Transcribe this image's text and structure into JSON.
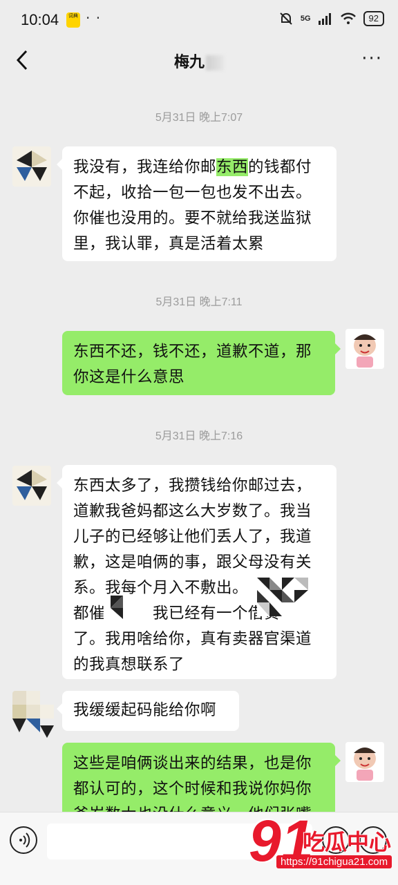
{
  "status_bar": {
    "time": "10:04",
    "app_badge": "词典",
    "network": "5G",
    "battery": "92"
  },
  "header": {
    "title": "梅九",
    "back_icon": "chevron-left-icon",
    "more_label": "···"
  },
  "messages": [
    {
      "timestamp": "5月31日 晚上7:07"
    },
    {
      "side": "left",
      "pre": "我没有，我连给你邮",
      "highlight": "东西",
      "post": "的钱都付不起，收拾一包一包也发不出去。你催也没用的。要不就给我送监狱里，我认罪，真是活着太累"
    },
    {
      "timestamp": "5月31日 晚上7:11"
    },
    {
      "side": "right",
      "text": "东西不还，钱不还，道歉不道，那你这是什么意思"
    },
    {
      "timestamp": "5月31日 晚上7:16"
    },
    {
      "side": "left",
      "text": "东西太多了，我攒钱给你邮过去，道歉我爸妈都这么大岁数了。我当儿子的已经够让他们丢人了，我道歉，这是咱俩的事，跟父母没有关系。我每个月入不敷出。　　　　　都催　　　我已经有一个借贷　　　了。我用啥给你，真有卖器官渠道的我真想联系了"
    },
    {
      "side": "left",
      "text": "我缓缓起码能给你啊"
    },
    {
      "side": "right",
      "text": "这些是咱俩谈出来的结果，也是你都认可的，这个时候和我说你妈你爸岁数大也没什么意义，他们张嘴"
    }
  ],
  "input_bar": {
    "voice_icon": "voice-icon",
    "emoji_icon": "emoji-icon",
    "plus_icon": "plus-icon"
  },
  "watermark": {
    "number": "91",
    "name": "吃瓜中心",
    "url": "https://91chigua21.com"
  },
  "colors": {
    "background": "#ededed",
    "bubble_self": "#95ec69",
    "bubble_other": "#ffffff",
    "watermark": "#e8192c"
  }
}
